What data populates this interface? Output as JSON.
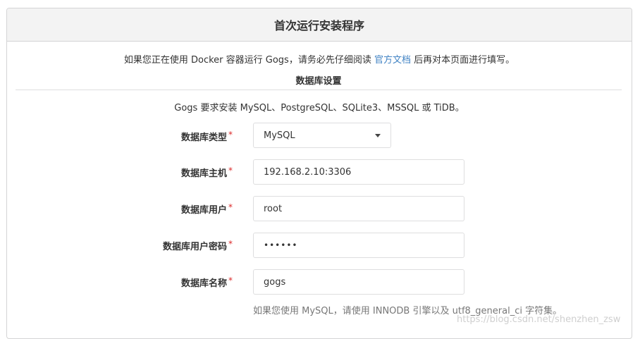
{
  "header": {
    "title": "首次运行安装程序"
  },
  "intro": {
    "before": "如果您正在使用 Docker 容器运行 Gogs，请务必先仔细阅读 ",
    "link": "官方文档",
    "after": " 后再对本页面进行填写。"
  },
  "section": {
    "title": "数据库设置"
  },
  "db_note": "Gogs 要求安装 MySQL、PostgreSQL、SQLite3、MSSQL 或 TiDB。",
  "fields": {
    "db_type": {
      "label": "数据库类型",
      "value": "MySQL"
    },
    "db_host": {
      "label": "数据库主机",
      "value": "192.168.2.10:3306"
    },
    "db_user": {
      "label": "数据库用户",
      "value": "root"
    },
    "db_password": {
      "label": "数据库用户密码",
      "value": "••••••"
    },
    "db_name": {
      "label": "数据库名称",
      "value": "gogs"
    }
  },
  "required_mark": "*",
  "help_text": "如果您使用 MySQL，请使用 INNODB 引擎以及 utf8_general_ci 字符集。",
  "watermark": "https://blog.csdn.net/shenzhen_zsw",
  "colors": {
    "link": "#4183c4",
    "required": "#db2828"
  }
}
